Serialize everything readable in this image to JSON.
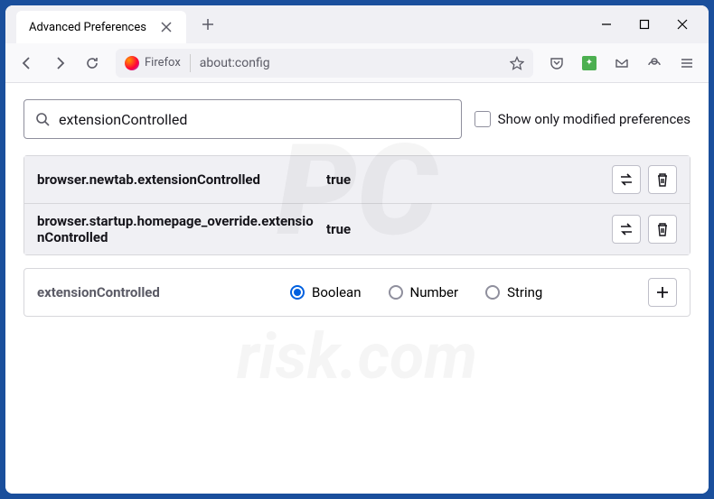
{
  "tab": {
    "title": "Advanced Preferences"
  },
  "urlbar": {
    "identity": "Firefox",
    "url": "about:config"
  },
  "search": {
    "value": "extensionControlled",
    "modified_only_label": "Show only modified preferences"
  },
  "prefs": [
    {
      "name": "browser.newtab.extensionControlled",
      "value": "true"
    },
    {
      "name": "browser.startup.homepage_override.extensionControlled",
      "value": "true"
    }
  ],
  "create": {
    "name": "extensionControlled",
    "types": {
      "boolean": "Boolean",
      "number": "Number",
      "string": "String"
    },
    "selected": "boolean"
  }
}
